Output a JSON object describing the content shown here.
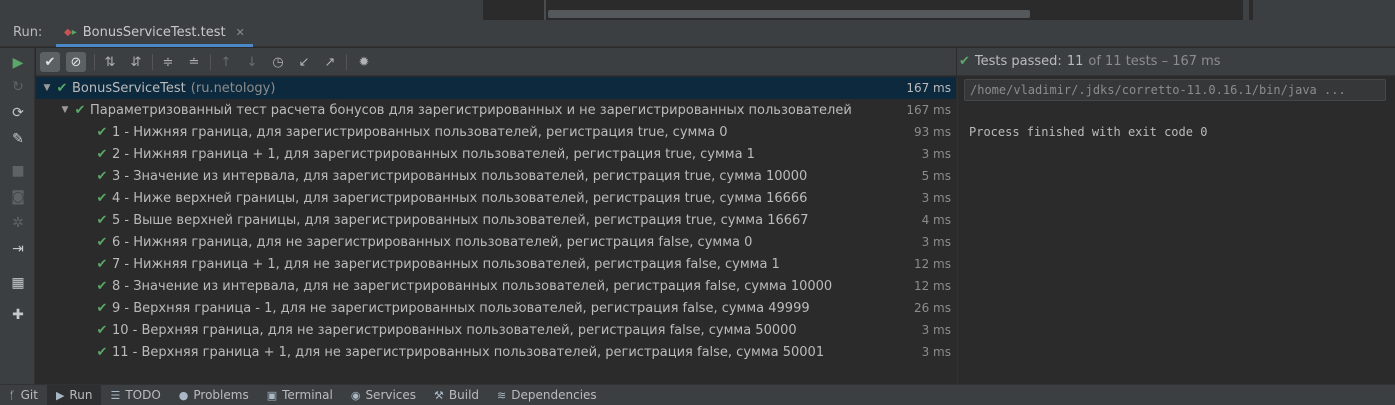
{
  "run_panel": {
    "label": "Run:",
    "tab_label": "BonusServiceTest.test"
  },
  "status": {
    "prefix": "Tests passed:",
    "passed": "11",
    "suffix": "of 11 tests – 167 ms"
  },
  "tree": {
    "root": {
      "label": "BonusServiceTest",
      "package": "(ru.netology)",
      "duration": "167 ms"
    },
    "group": {
      "label": "Параметризованный тест расчета бонусов для зарегистрированных и не зарегистрированных пользователей",
      "duration": "167 ms"
    },
    "tests": [
      {
        "label": "1 - Нижняя граница, для зарегистрированных пользователей, регистрация true, сумма 0",
        "duration": "93 ms"
      },
      {
        "label": "2 - Нижняя граница + 1, для зарегистрированных пользователей, регистрация true, сумма 1",
        "duration": "3 ms"
      },
      {
        "label": "3 - Значение из интервала, для зарегистрированных пользователей, регистрация true, сумма 10000",
        "duration": "5 ms"
      },
      {
        "label": "4 - Ниже верхней границы, для зарегистрированных пользователей, регистрация true, сумма 16666",
        "duration": "3 ms"
      },
      {
        "label": "5 - Выше верхней границы, для зарегистрированных пользователей, регистрация true, сумма 16667",
        "duration": "4 ms"
      },
      {
        "label": "6 - Нижняя граница, для не зарегистрированных пользователей, регистрация false, сумма 0",
        "duration": "3 ms"
      },
      {
        "label": "7 - Нижняя граница + 1, для не зарегистрированных пользователей, регистрация false, сумма 1",
        "duration": "12 ms"
      },
      {
        "label": "8 - Значение из интервала, для не зарегистрированных пользователей, регистрация false, сумма 10000",
        "duration": "12 ms"
      },
      {
        "label": "9 - Верхняя граница - 1, для не зарегистрированных пользователей, регистрация false, сумма 49999",
        "duration": "26 ms"
      },
      {
        "label": "10 - Верхняя граница, для не зарегистрированных пользователей, регистрация false, сумма 50000",
        "duration": "3 ms"
      },
      {
        "label": "11 - Верхняя граница + 1, для не зарегистрированных пользователей, регистрация false, сумма 50001",
        "duration": "3 ms"
      }
    ]
  },
  "console": {
    "command": "/home/vladimir/.jdks/corretto-11.0.16.1/bin/java",
    "ellipsis": "...",
    "output": "Process finished with exit code 0"
  },
  "bottom_tabs": [
    {
      "label": "Git",
      "icon": "git-branch-icon"
    },
    {
      "label": "Run",
      "icon": "play-icon"
    },
    {
      "label": "TODO",
      "icon": "list-icon"
    },
    {
      "label": "Problems",
      "icon": "info-icon"
    },
    {
      "label": "Terminal",
      "icon": "terminal-icon"
    },
    {
      "label": "Services",
      "icon": "services-icon"
    },
    {
      "label": "Build",
      "icon": "hammer-icon"
    },
    {
      "label": "Dependencies",
      "icon": "layers-icon"
    }
  ],
  "colors": {
    "pass_green": "#59a869",
    "selection": "#0d293e",
    "panel_bg": "#3c3f41",
    "editor_bg": "#2b2b2b",
    "text": "#bbbbbb",
    "muted": "#8c8c8c"
  }
}
